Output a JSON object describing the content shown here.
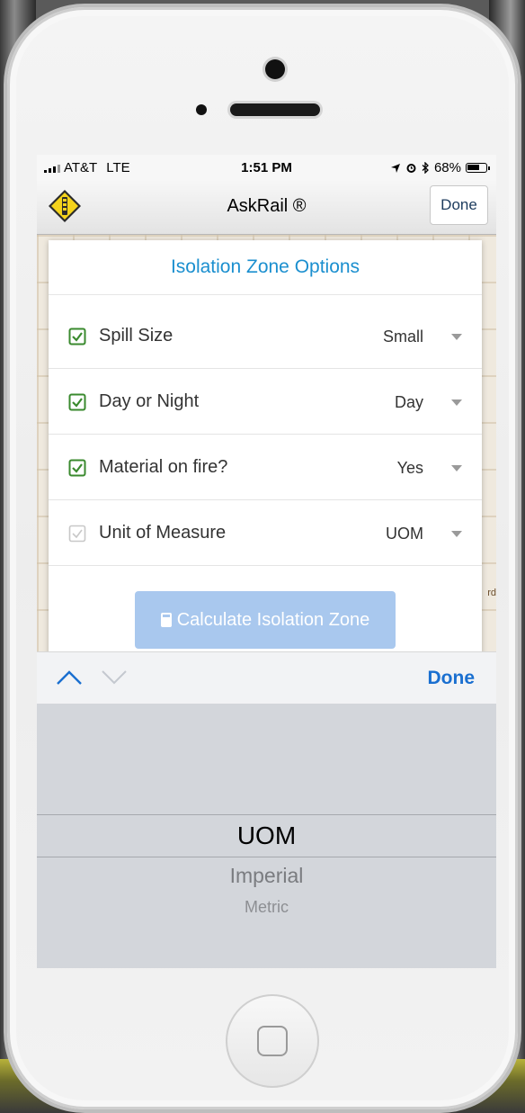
{
  "status_bar": {
    "carrier": "AT&T",
    "network": "LTE",
    "time": "1:51 PM",
    "battery": "68%",
    "battery_fraction": 0.68,
    "icons": [
      "signal-bars-icon",
      "location-arrow-icon",
      "alarm-icon",
      "bluetooth-icon",
      "battery-icon"
    ]
  },
  "nav": {
    "title": "AskRail ®",
    "done_label": "Done",
    "logo_icon": "askrail-logo-icon"
  },
  "map": {
    "label": "rd"
  },
  "modal": {
    "title": "Isolation Zone Options",
    "options": [
      {
        "label": "Spill Size",
        "value": "Small",
        "checked": true
      },
      {
        "label": "Day or Night",
        "value": "Day",
        "checked": true
      },
      {
        "label": "Material on fire?",
        "value": "Yes",
        "checked": true
      },
      {
        "label": "Unit of Measure",
        "value": "UOM",
        "checked": false
      }
    ],
    "calculate_label": "Calculate Isolation Zone",
    "calculate_icon": "calculator-icon"
  },
  "picker_bar": {
    "done_label": "Done",
    "prev_icon": "chevron-up-icon",
    "next_icon": "chevron-down-icon"
  },
  "picker": {
    "items": [
      "UOM",
      "Imperial",
      "Metric"
    ],
    "selected": "UOM"
  },
  "colors": {
    "accent_blue": "#1b8fcf",
    "done_blue": "#1a6fd0",
    "check_green": "#3a8a2e",
    "calc_button": "#a9c8ee"
  }
}
